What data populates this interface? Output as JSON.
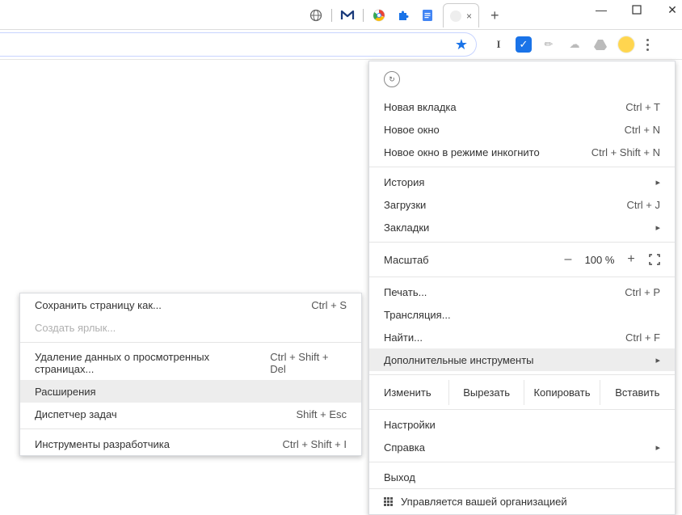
{
  "window_controls": {
    "minimize": "—",
    "maximize": "☐",
    "close": "✕"
  },
  "tabstrip": {
    "icons": [
      "globe",
      "malwarebytes",
      "chrome",
      "puzzle",
      "docs"
    ],
    "active_tab_close": "×",
    "new_tab": "+"
  },
  "toolbar": {
    "star": "★",
    "letter_i": "I",
    "check": "✓",
    "brush": "✎",
    "cloud": "⬟",
    "drive": "△"
  },
  "menu": {
    "badge": "⟲",
    "new_tab": {
      "label": "Новая вкладка",
      "shortcut": "Ctrl + T"
    },
    "new_window": {
      "label": "Новое окно",
      "shortcut": "Ctrl + N"
    },
    "incognito": {
      "label": "Новое окно в режиме инкогнито",
      "shortcut": "Ctrl + Shift + N"
    },
    "history": {
      "label": "История"
    },
    "downloads": {
      "label": "Загрузки",
      "shortcut": "Ctrl + J"
    },
    "bookmarks": {
      "label": "Закладки"
    },
    "zoom": {
      "label": "Масштаб",
      "minus": "–",
      "value": "100 %",
      "plus": "+",
      "fullscreen": "⛶"
    },
    "print": {
      "label": "Печать...",
      "shortcut": "Ctrl + P"
    },
    "cast": {
      "label": "Трансляция..."
    },
    "find": {
      "label": "Найти...",
      "shortcut": "Ctrl + F"
    },
    "more_tools": {
      "label": "Дополнительные инструменты"
    },
    "edit": {
      "label": "Изменить",
      "cut": "Вырезать",
      "copy": "Копировать",
      "paste": "Вставить"
    },
    "settings": {
      "label": "Настройки"
    },
    "help": {
      "label": "Справка"
    },
    "exit": {
      "label": "Выход"
    },
    "managed": {
      "label": "Управляется вашей организацией"
    }
  },
  "submenu": {
    "save_page": {
      "label": "Сохранить страницу как...",
      "shortcut": "Ctrl + S"
    },
    "create_shortcut": {
      "label": "Создать ярлык..."
    },
    "clear_browsing": {
      "label": "Удаление данных о просмотренных страницах...",
      "shortcut": "Ctrl + Shift + Del"
    },
    "extensions": {
      "label": "Расширения"
    },
    "task_manager": {
      "label": "Диспетчер задач",
      "shortcut": "Shift + Esc"
    },
    "dev_tools": {
      "label": "Инструменты разработчика",
      "shortcut": "Ctrl + Shift + I"
    }
  }
}
